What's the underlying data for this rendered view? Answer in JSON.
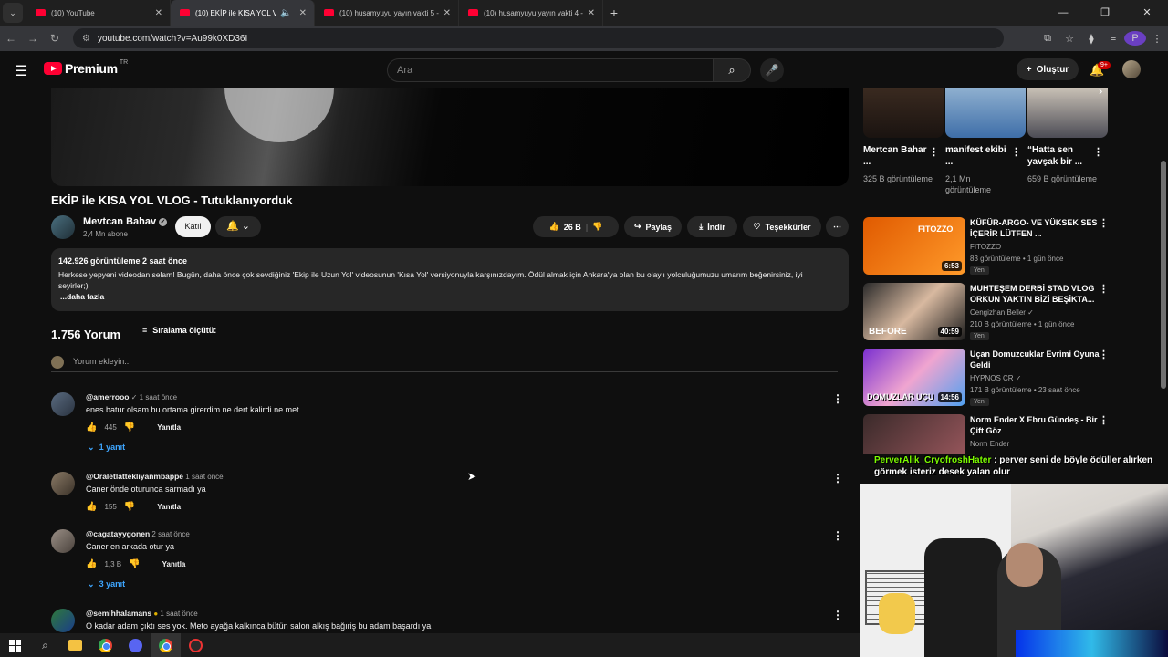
{
  "browser": {
    "tabs": [
      {
        "title": "(10) YouTube",
        "active": false
      },
      {
        "title": "(10) EKİP ile KISA YOL VLOG",
        "active": true
      },
      {
        "title": "(10) husamyuyu yayın vakti 5 -",
        "active": false
      },
      {
        "title": "(10) husamyuyu yayın vakti 4 -",
        "active": false
      }
    ],
    "url": "youtube.com/watch?v=Au99k0XD36I",
    "profile_letter": "P"
  },
  "youtube": {
    "logo_text": "Premium",
    "logo_region": "TR",
    "search_placeholder": "Ara",
    "create_label": "Oluştur",
    "notif_count": "9+"
  },
  "video": {
    "title": "EKİP ile KISA YOL VLOG - Tutuklanıyorduk",
    "channel": "Mevtcan Bahav",
    "subscribers": "2,4 Mn abone",
    "join_label": "Katıl",
    "likes": "26 B",
    "share_label": "Paylaş",
    "download_label": "İndir",
    "thanks_label": "Teşekkürler",
    "views_line": "142.926 görüntüleme  2 saat önce",
    "description": "Herkese yepyeni videodan selam! Bugün, daha önce çok sevdiğiniz 'Ekip ile Uzun Yol' videosunun 'Kısa Yol' versiyonuyla karşınızdayım. Ödül almak için Ankara'ya olan bu olaylı yolculuğumuzu umarım beğenirsiniz, iyi seyirler;)",
    "more_label": "...daha fazla"
  },
  "comments_section": {
    "count_label": "1.756 Yorum",
    "sort_label": "Sıralama ölçütü:",
    "add_placeholder": "Yorum ekleyin...",
    "reply_label": "Yanıtla",
    "comments": [
      {
        "handle": "@amerrooo",
        "time": "1 saat önce",
        "text": "enes batur olsam bu ortama girerdim ne dert kalirdi ne met",
        "likes": "445",
        "replies": "1 yanıt"
      },
      {
        "handle": "@Oraletlattekliyanmbappe",
        "time": "1 saat önce",
        "text": "Caner önde oturunca sarmadı ya",
        "likes": "155",
        "replies": ""
      },
      {
        "handle": "@cagatayygonen",
        "time": "2 saat önce",
        "text": "Caner en arkada otur ya",
        "likes": "1,3 B",
        "replies": "3 yanıt"
      },
      {
        "handle": "@semihhalamans",
        "time": "1 saat önce",
        "text": "O kadar adam çıktı ses yok. Meto ayağa kalkınca bütün salon alkış bağıriş bu adam başardı ya",
        "likes": "",
        "replies": ""
      }
    ]
  },
  "related_top": [
    {
      "title": "Mertcan Bahar ...",
      "views": "325 B görüntüleme"
    },
    {
      "title": "manifest ekibi ...",
      "views": "2,1 Mn görüntüleme"
    },
    {
      "title": "“Hatta sen yavşak bir ...",
      "views": "659 B görüntüleme"
    }
  ],
  "related": [
    {
      "title": "KÜFÜR-ARGO- VE YÜKSEK SES İÇERİR LÜTFEN ...",
      "channel": "FITOZZO",
      "meta": "83 görüntüleme • 1 gün önce",
      "badge": "Yeni",
      "duration": "6:53",
      "thumb_text": "FITOZZO"
    },
    {
      "title": "MUHTEŞEM DERBİ STAD VLOG ORKUN YAKTIN BİZİ BEŞİKTA...",
      "channel": "Cengizhan Beller",
      "meta": "210 B görüntüleme • 1 gün önce",
      "badge": "Yeni",
      "duration": "40:59",
      "thumb_text": "BEFORE"
    },
    {
      "title": "Uçan Domuzcuklar Evrimi Oyuna Geldi",
      "channel": "HYPNOS CR",
      "meta": "171 B görüntüleme • 23 saat önce",
      "badge": "Yeni",
      "duration": "14:56",
      "thumb_text": "DOMUZLAR UÇU"
    },
    {
      "title": "Norm Ender X Ebru Gündeş - Bir Çift Göz",
      "channel": "Norm Ender",
      "meta": "",
      "badge": "",
      "duration": "",
      "thumb_text": ""
    }
  ],
  "chat_overlay": {
    "user": "PerverAlik_CryofroshHater",
    "message": " : perver seni de böyle ödüller alırken görmek isteriz desek yalan olur"
  }
}
